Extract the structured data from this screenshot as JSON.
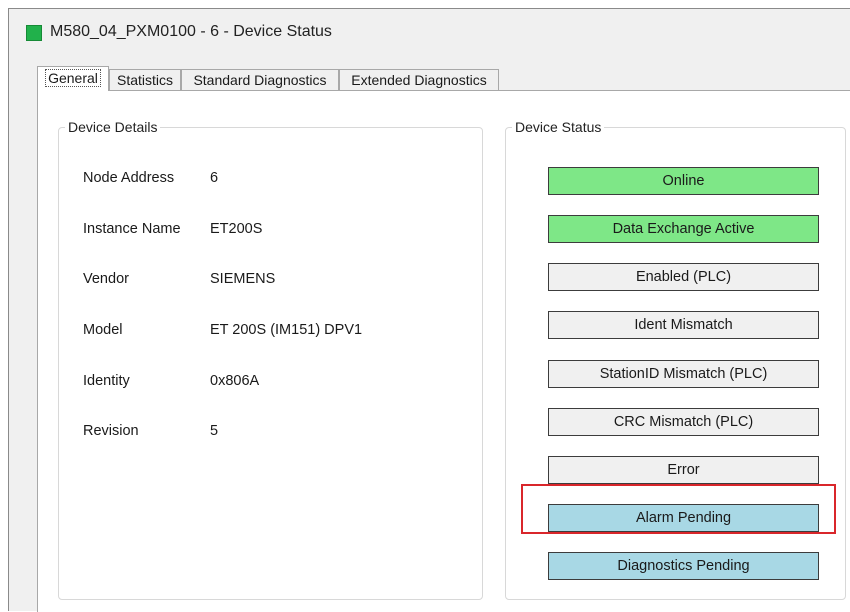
{
  "window": {
    "title": "M580_04_PXM0100 - 6 - Device Status",
    "icon": "device-status-icon",
    "icon_color": "#21b14b"
  },
  "tabs": [
    {
      "label": "General",
      "active": true
    },
    {
      "label": "Statistics",
      "active": false
    },
    {
      "label": "Standard Diagnostics",
      "active": false
    },
    {
      "label": "Extended Diagnostics",
      "active": false
    }
  ],
  "device_details": {
    "legend": "Device Details",
    "rows": [
      {
        "label": "Node Address",
        "value": "6"
      },
      {
        "label": "Instance Name",
        "value": "ET200S"
      },
      {
        "label": "Vendor",
        "value": "SIEMENS"
      },
      {
        "label": "Model",
        "value": "ET 200S (IM151) DPV1"
      },
      {
        "label": "Identity",
        "value": "0x806A"
      },
      {
        "label": "Revision",
        "value": "5"
      }
    ]
  },
  "device_status": {
    "legend": "Device Status",
    "indicators": [
      {
        "label": "Online",
        "state": "green"
      },
      {
        "label": "Data Exchange Active",
        "state": "green"
      },
      {
        "label": "Enabled (PLC)",
        "state": "off"
      },
      {
        "label": "Ident Mismatch",
        "state": "off"
      },
      {
        "label": "StationID Mismatch (PLC)",
        "state": "off"
      },
      {
        "label": "CRC Mismatch (PLC)",
        "state": "off"
      },
      {
        "label": "Error",
        "state": "off"
      },
      {
        "label": "Alarm Pending",
        "state": "blue",
        "highlighted": true
      },
      {
        "label": "Diagnostics Pending",
        "state": "blue"
      }
    ]
  },
  "colors": {
    "green": "#7ee787",
    "off": "#f0f0f0",
    "blue": "#a8d8e5",
    "highlight": "#d9262b"
  }
}
